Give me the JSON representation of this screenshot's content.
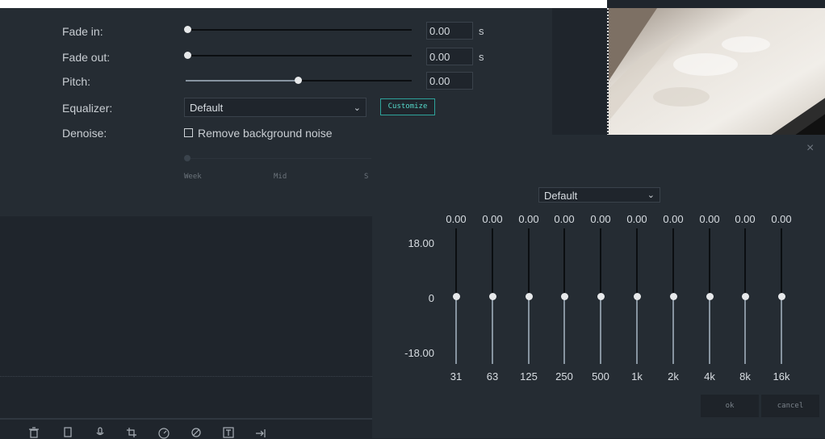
{
  "audio": {
    "fade_in_label": "Fade in:",
    "fade_in_value": "0.00",
    "fade_in_unit": "s",
    "fade_out_label": "Fade out:",
    "fade_out_value": "0.00",
    "fade_out_unit": "s",
    "pitch_label": "Pitch:",
    "pitch_value": "0.00",
    "equalizer_label": "Equalizer:",
    "equalizer_selected": "Default",
    "customize_label": "Customize",
    "denoise_label": "Denoise:",
    "denoise_checkbox_label": "Remove background noise",
    "denoise_checked": false,
    "denoise_levels": [
      "Week",
      "Mid",
      "S"
    ]
  },
  "equalizer_dialog": {
    "preset": "Default",
    "db_max": "18.00",
    "db_zero": "0",
    "db_min": "-18.00",
    "bands": [
      {
        "freq": "31",
        "gain": "0.00"
      },
      {
        "freq": "63",
        "gain": "0.00"
      },
      {
        "freq": "125",
        "gain": "0.00"
      },
      {
        "freq": "250",
        "gain": "0.00"
      },
      {
        "freq": "500",
        "gain": "0.00"
      },
      {
        "freq": "1k",
        "gain": "0.00"
      },
      {
        "freq": "2k",
        "gain": "0.00"
      },
      {
        "freq": "4k",
        "gain": "0.00"
      },
      {
        "freq": "8k",
        "gain": "0.00"
      },
      {
        "freq": "16k",
        "gain": "0.00"
      }
    ],
    "ok_label": "ok",
    "cancel_label": "cancel",
    "close_glyph": "×"
  },
  "toolbar": {
    "icons": [
      "trash-icon",
      "crop-frame-icon",
      "microphone-icon",
      "crop-icon",
      "speed-icon",
      "color-icon",
      "text-icon",
      "export-icon"
    ]
  },
  "colors": {
    "accent": "#2ea39b",
    "panel": "#252c33",
    "background": "#1f252c"
  }
}
